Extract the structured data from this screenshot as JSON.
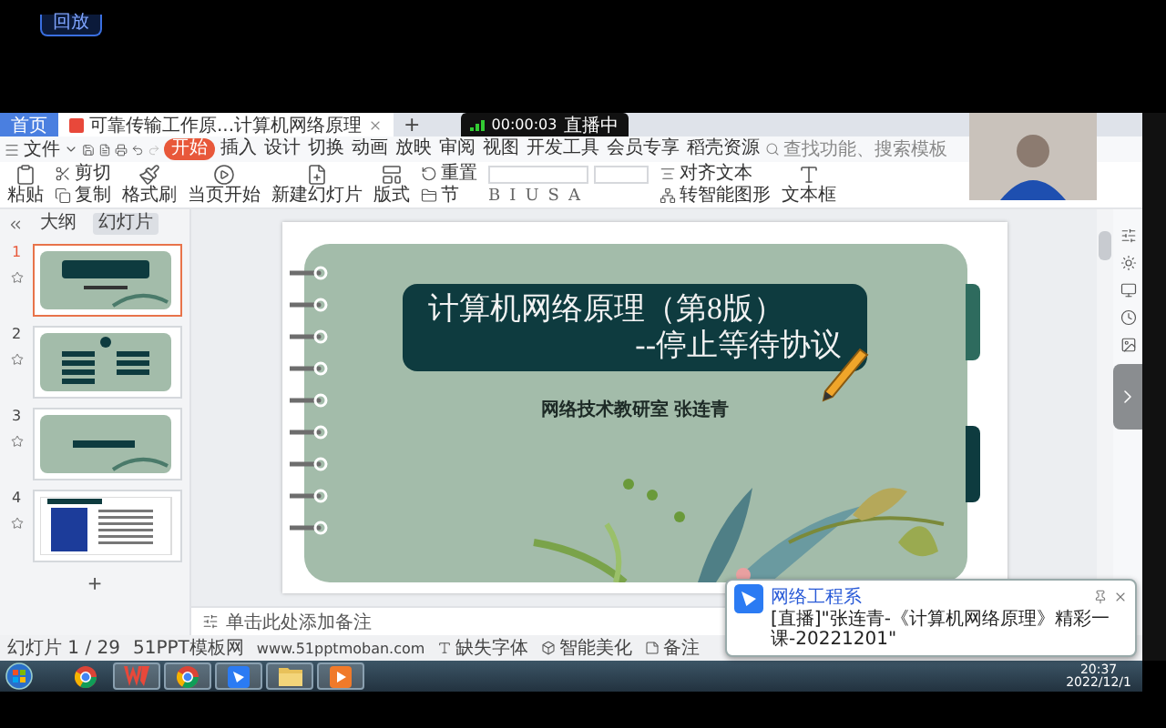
{
  "overlay": {
    "replay_button": "回放"
  },
  "title_bar": {
    "tabs": [
      {
        "label": "首页",
        "kind": "home",
        "selected": false
      },
      {
        "label": "可靠传输工作原...计算机网络原理",
        "kind": "document",
        "selected": true
      }
    ],
    "new_tab": "+",
    "live": {
      "timer": "00:00:03",
      "status": "直播中"
    }
  },
  "menu": {
    "file": "文件",
    "tabs": [
      {
        "label": "开始",
        "selected": true
      },
      {
        "label": "插入",
        "selected": false
      },
      {
        "label": "设计",
        "selected": false
      },
      {
        "label": "切换",
        "selected": false
      },
      {
        "label": "动画",
        "selected": false
      },
      {
        "label": "放映",
        "selected": false
      },
      {
        "label": "审阅",
        "selected": false
      },
      {
        "label": "视图",
        "selected": false
      },
      {
        "label": "开发工具",
        "selected": false
      },
      {
        "label": "会员专享",
        "selected": false
      },
      {
        "label": "稻壳资源",
        "selected": false
      }
    ],
    "search": {
      "placeholder": "查找功能、搜索模板"
    }
  },
  "toolbar": {
    "groups": [
      {
        "kind": "large",
        "label": "粘贴"
      },
      {
        "kind": "stack",
        "items": [
          "剪切",
          "复制"
        ]
      },
      {
        "kind": "large",
        "label": "格式刷"
      },
      {
        "kind": "large",
        "label": "当页开始"
      },
      {
        "kind": "large",
        "label": "新建幻灯片"
      },
      {
        "kind": "large",
        "label": "版式"
      },
      {
        "kind": "stack",
        "items": [
          "重置",
          "节"
        ]
      },
      {
        "kind": "font",
        "buttons": [
          "B",
          "I",
          "U",
          "S",
          "A"
        ]
      },
      {
        "kind": "stack",
        "items": [
          "对齐文本",
          "转智能图形"
        ]
      },
      {
        "kind": "large",
        "label": "文本框"
      }
    ]
  },
  "sidebar": {
    "tabs": [
      {
        "label": "大纲",
        "selected": false
      },
      {
        "label": "幻灯片",
        "selected": true
      }
    ],
    "slides": [
      {
        "number": "1",
        "kind": "title",
        "selected": true
      },
      {
        "number": "2",
        "kind": "menu",
        "selected": false
      },
      {
        "number": "3",
        "kind": "section",
        "selected": false
      },
      {
        "number": "4",
        "kind": "content",
        "selected": false
      }
    ],
    "add": "+"
  },
  "slide": {
    "title": "计算机网络原理（第8版）",
    "subtitle": "--停止等待协议",
    "author": "网络技术教研室  张连青"
  },
  "notes": {
    "placeholder": "单击此处添加备注"
  },
  "status_bar": {
    "slide_count": "幻灯片 1 / 29",
    "source": "51PPT模板网",
    "url": "www.51pptmoban.com",
    "missing_fonts": "缺失字体",
    "beautify": "智能美化",
    "notes": "备注"
  },
  "notification": {
    "app": "网络工程系",
    "message": "[直播]\"张连青-《计算机网络原理》精彩一课-20221201\""
  },
  "taskbar": {
    "apps": [
      {
        "kind": "browser",
        "running": false
      },
      {
        "kind": "office",
        "running": true
      },
      {
        "kind": "browser",
        "running": true
      },
      {
        "kind": "messenger",
        "running": true
      },
      {
        "kind": "folder",
        "running": true
      },
      {
        "kind": "recorder",
        "running": true
      }
    ],
    "time": "20:37",
    "date": "2022/12/1"
  }
}
